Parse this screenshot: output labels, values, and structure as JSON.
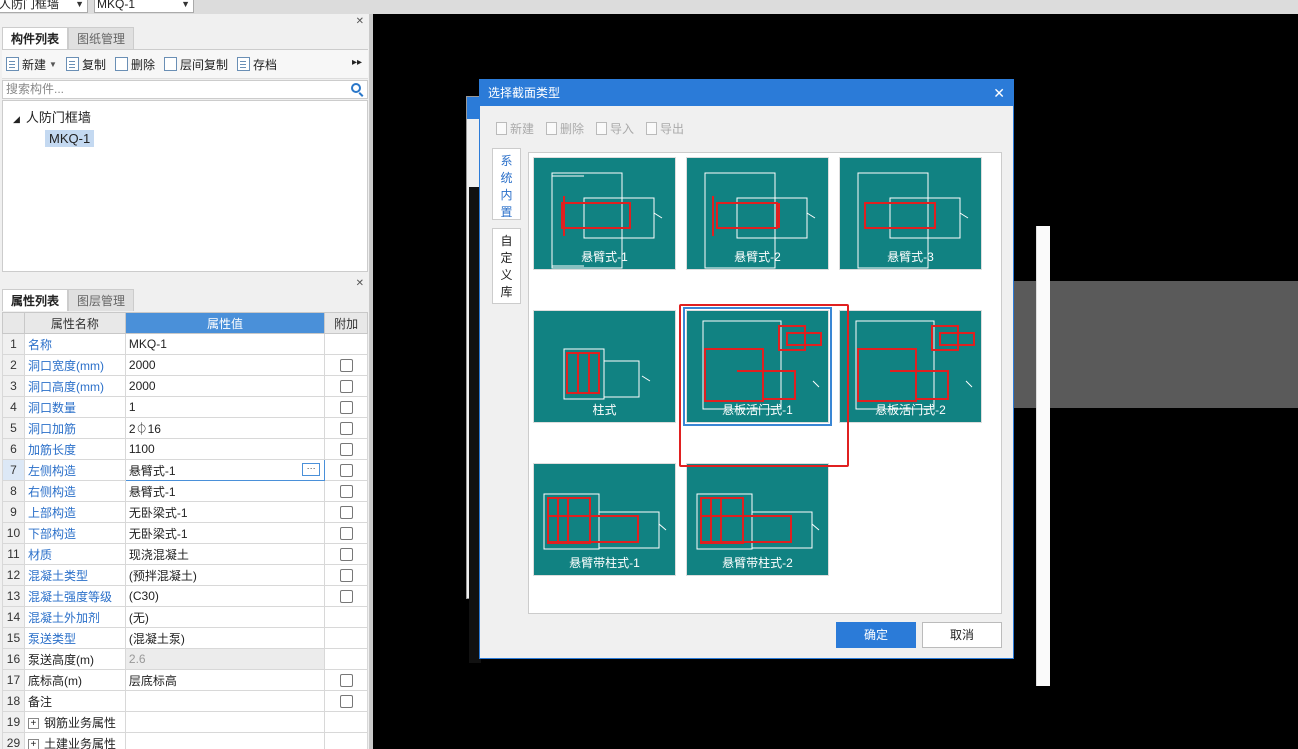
{
  "topbar": {
    "floor_combo": "人防门框墙",
    "component_combo": "MKQ-1"
  },
  "component_panel": {
    "tabs": [
      "构件列表",
      "图纸管理"
    ],
    "toolbar": {
      "new": "新建",
      "copy": "复制",
      "delete": "删除",
      "floor_copy": "层间复制",
      "archive": "存档"
    },
    "search_placeholder": "搜索构件...",
    "tree": {
      "root": "人防门框墙",
      "child": "MKQ-1"
    }
  },
  "property_panel": {
    "tabs": [
      "属性列表",
      "图层管理"
    ],
    "headers": [
      "属性名称",
      "属性值",
      "附加"
    ],
    "rows": [
      {
        "num": "1",
        "name": "名称",
        "value": "MKQ-1",
        "checkbox": false,
        "link": true
      },
      {
        "num": "2",
        "name": "洞口宽度(mm)",
        "value": "2000",
        "checkbox": true,
        "link": true
      },
      {
        "num": "3",
        "name": "洞口高度(mm)",
        "value": "2000",
        "checkbox": true,
        "link": true
      },
      {
        "num": "4",
        "name": "洞口数量",
        "value": "1",
        "checkbox": true,
        "link": true
      },
      {
        "num": "5",
        "name": "洞口加筋",
        "value": "2⏀16",
        "checkbox": true,
        "link": true
      },
      {
        "num": "6",
        "name": "加筋长度",
        "value": "1100",
        "checkbox": true,
        "link": true
      },
      {
        "num": "7",
        "name": "左侧构造",
        "value": "悬臂式-1",
        "checkbox": true,
        "link": true,
        "selected": true
      },
      {
        "num": "8",
        "name": "右侧构造",
        "value": "悬臂式-1",
        "checkbox": true,
        "link": true
      },
      {
        "num": "9",
        "name": "上部构造",
        "value": "无卧梁式-1",
        "checkbox": true,
        "link": true
      },
      {
        "num": "10",
        "name": "下部构造",
        "value": "无卧梁式-1",
        "checkbox": true,
        "link": true
      },
      {
        "num": "11",
        "name": "材质",
        "value": "现浇混凝土",
        "checkbox": true,
        "link": true
      },
      {
        "num": "12",
        "name": "混凝土类型",
        "value": "(预拌混凝土)",
        "checkbox": true,
        "link": true
      },
      {
        "num": "13",
        "name": "混凝土强度等级",
        "value": "(C30)",
        "checkbox": true,
        "link": true
      },
      {
        "num": "14",
        "name": "混凝土外加剂",
        "value": "(无)",
        "checkbox": false,
        "link": true
      },
      {
        "num": "15",
        "name": "泵送类型",
        "value": "(混凝土泵)",
        "checkbox": false,
        "link": true
      },
      {
        "num": "16",
        "name": "泵送高度(m)",
        "value": "2.6",
        "checkbox": false,
        "link": false,
        "grey": true
      },
      {
        "num": "17",
        "name": "底标高(m)",
        "value": "层底标高",
        "checkbox": true,
        "link": false
      },
      {
        "num": "18",
        "name": "备注",
        "value": "",
        "checkbox": true,
        "link": false
      },
      {
        "num": "19",
        "name": "钢筋业务属性",
        "value": "",
        "checkbox": false,
        "link": false,
        "group": true
      },
      {
        "num": "29",
        "name": "土建业务属性",
        "value": "",
        "checkbox": false,
        "link": false,
        "group": true
      }
    ]
  },
  "dialog": {
    "title": "选择截面类型",
    "toolbar": [
      "新建",
      "删除",
      "导入",
      "导出"
    ],
    "side_tabs": [
      {
        "label": "系统内置",
        "active": true
      },
      {
        "label": "自定义库",
        "active": false
      }
    ],
    "sections": [
      {
        "label": "悬臂式-1"
      },
      {
        "label": "悬臂式-2"
      },
      {
        "label": "悬臂式-3"
      },
      {
        "label": "柱式"
      },
      {
        "label": "悬板活门式-1",
        "selected": true
      },
      {
        "label": "悬板活门式-2"
      },
      {
        "label": "悬臂带柱式-1"
      },
      {
        "label": "悬臂带柱式-2"
      }
    ],
    "ok": "确定",
    "cancel": "取消"
  },
  "colors": {
    "accent": "#2b7bd8",
    "tile": "#118282",
    "rebar": "#e02020",
    "highlight": "#e02020"
  }
}
